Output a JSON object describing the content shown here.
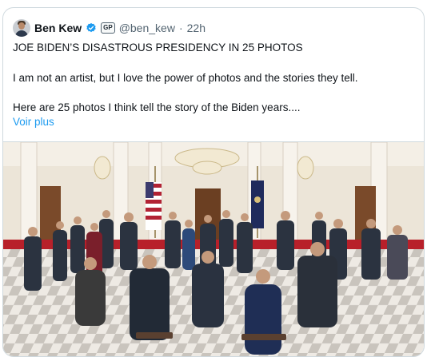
{
  "post": {
    "author_name": "Ben Kew",
    "badge_text": "GP",
    "handle": "@ben_kew",
    "separator": "·",
    "time": "22h",
    "line1": "JOE BIDEN’S DISASTROUS PRESIDENCY IN 25 PHOTOS",
    "line2": "I am not an artist, but I love the power of photos and the stories they tell.",
    "line3": "Here are 25 photos I think tell the story of the Biden years....",
    "more_label": "Voir plus"
  },
  "icons": {
    "verified": "verified-badge-icon",
    "affiliation": "gp-affiliation-icon"
  },
  "colors": {
    "accent": "#1d9bf0",
    "text": "#0f1419",
    "muted": "#536471",
    "border": "#cfd9de"
  }
}
